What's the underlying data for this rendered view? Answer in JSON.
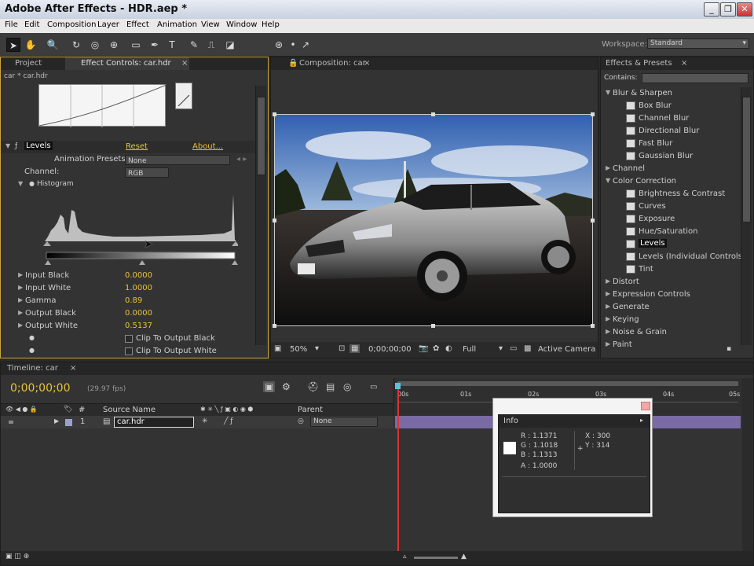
{
  "window": {
    "title": "Adobe After Effects - HDR.aep *",
    "controls": [
      "_",
      "❐",
      "✕"
    ]
  },
  "menu": [
    "File",
    "Edit",
    "Composition",
    "Layer",
    "Effect",
    "Animation",
    "View",
    "Window",
    "Help"
  ],
  "workspace": {
    "label": "Workspace:",
    "value": "Standard"
  },
  "left_panel": {
    "tabs": [
      "Project",
      "Effect Controls: car.hdr"
    ],
    "breadcrumb": "car * car.hdr",
    "effect": {
      "name": "Levels",
      "reset": "Reset",
      "about": "About...",
      "presets_label": "Animation Presets:",
      "presets_value": "None",
      "channel_label": "Channel:",
      "channel_value": "RGB",
      "histogram_label": "Histogram",
      "properties": [
        {
          "label": "Input Black",
          "value": "0.0000"
        },
        {
          "label": "Input White",
          "value": "1.0000"
        },
        {
          "label": "Gamma",
          "value": "0.89"
        },
        {
          "label": "Output Black",
          "value": "0.0000"
        },
        {
          "label": "Output White",
          "value": "0.5137"
        }
      ],
      "checkboxes": [
        "Clip To Output Black",
        "Clip To Output White"
      ]
    }
  },
  "composition": {
    "tab": "Composition: car",
    "zoom": "50%",
    "timecode": "0;00;00;00",
    "resolution": "Full",
    "camera": "Active Camera"
  },
  "effects_presets": {
    "tab": "Effects & Presets",
    "contains_label": "Contains:",
    "tree": [
      {
        "type": "cat",
        "label": "Blur & Sharpen",
        "open": true
      },
      {
        "type": "fx",
        "label": "Box Blur"
      },
      {
        "type": "fx",
        "label": "Channel Blur"
      },
      {
        "type": "fx",
        "label": "Directional Blur"
      },
      {
        "type": "fx",
        "label": "Fast Blur"
      },
      {
        "type": "fx",
        "label": "Gaussian Blur"
      },
      {
        "type": "cat",
        "label": "Channel",
        "open": false
      },
      {
        "type": "cat",
        "label": "Color Correction",
        "open": true
      },
      {
        "type": "fx",
        "label": "Brightness & Contrast"
      },
      {
        "type": "fx",
        "label": "Curves"
      },
      {
        "type": "fx",
        "label": "Exposure"
      },
      {
        "type": "fx",
        "label": "Hue/Saturation"
      },
      {
        "type": "fx",
        "label": "Levels",
        "selected": true
      },
      {
        "type": "fx",
        "label": "Levels (Individual Controls)"
      },
      {
        "type": "fx",
        "label": "Tint"
      },
      {
        "type": "cat",
        "label": "Distort",
        "open": false
      },
      {
        "type": "cat",
        "label": "Expression Controls",
        "open": false
      },
      {
        "type": "cat",
        "label": "Generate",
        "open": false
      },
      {
        "type": "cat",
        "label": "Keying",
        "open": false
      },
      {
        "type": "cat",
        "label": "Noise & Grain",
        "open": false
      },
      {
        "type": "cat",
        "label": "Paint",
        "open": false
      }
    ]
  },
  "timeline": {
    "tab": "Timeline: car",
    "timecode": "0;00;00;00",
    "fps": "(29.97 fps)",
    "columns": {
      "hash": "#",
      "source": "Source Name",
      "parent": "Parent"
    },
    "layer": {
      "index": "1",
      "name": "car.hdr",
      "parent": "None"
    },
    "ruler": [
      "00s",
      "01s",
      "02s",
      "03s",
      "04s",
      "05s"
    ]
  },
  "info": {
    "title": "Info",
    "R": "R : 1.1371",
    "G": "G : 1.1018",
    "B": "B : 1.1313",
    "A": "A : 1.0000",
    "X": "X : 300",
    "Y": "Y : 314"
  }
}
